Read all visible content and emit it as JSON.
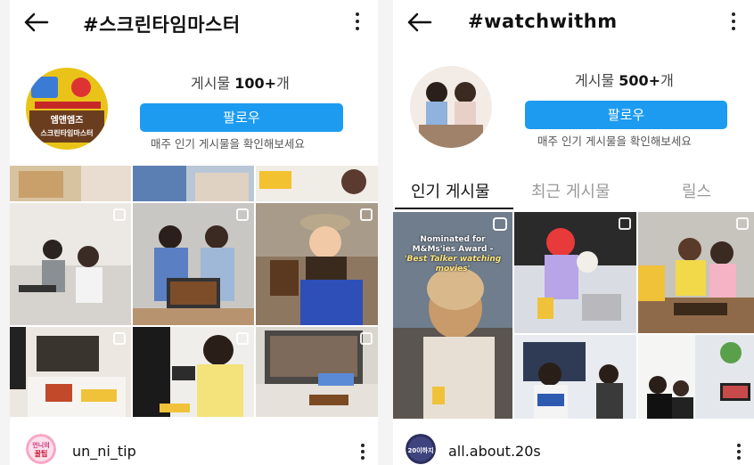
{
  "left_profile": {
    "title": "#스크린타임마스터",
    "posts_prefix": "게시물 ",
    "posts_count": "100+",
    "posts_suffix": "개",
    "follow_label": "팔로우",
    "subtitle": "매주 인기 게시물을 확인해보세요",
    "avatar_lines": [
      "엠앤엠즈",
      "스크린타임마스터"
    ],
    "footer_account": "un_ni_tip",
    "footer_avatar_text": [
      "언니의",
      "꿀팁"
    ]
  },
  "right_profile": {
    "title": "#watchwithm",
    "posts_prefix": "게시물 ",
    "posts_count": "500+",
    "posts_suffix": "개",
    "follow_label": "팔로우",
    "subtitle": "매주 인기 게시물을 확인해보세요",
    "tabs": [
      "인기 게시물",
      "최근 게시물",
      "릴스"
    ],
    "active_tab": "인기 게시물",
    "reel_caption": [
      "Nominated for",
      "M&Ms'ies Award -",
      "'Best Talker watching",
      "movies'"
    ],
    "footer_account": "all.about.20s",
    "footer_avatar_text": "20이하지"
  },
  "icons": {
    "back": "arrow-left-icon",
    "menu": "more-vertical-icon",
    "multi": "multiple-photos-icon",
    "reel": "reels-icon"
  },
  "colors": {
    "follow_button": "#1d9bf0",
    "text_primary": "#111111",
    "text_secondary": "#555555"
  }
}
